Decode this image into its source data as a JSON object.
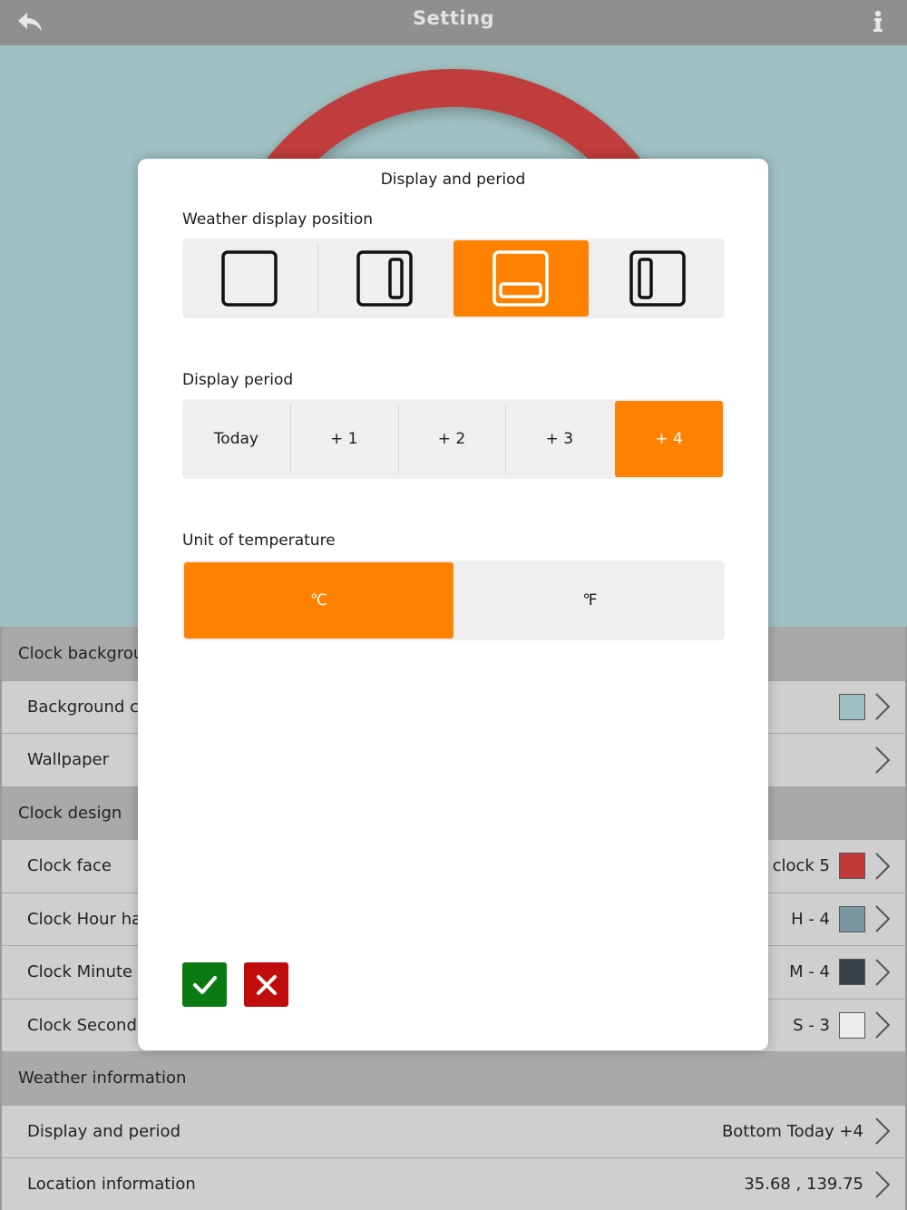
{
  "topbar": {
    "title": "Setting",
    "back_icon": "back-arrow-icon",
    "info_icon": "info-icon"
  },
  "colors": {
    "accent": "#ff8100",
    "ok": "#0b7a13",
    "cancel": "#c10c0c",
    "ring": "#bf3d3c"
  },
  "settings": {
    "rows": [
      {
        "type": "section",
        "label": "Clock background"
      },
      {
        "type": "item",
        "label": "Background color",
        "value": "",
        "swatch": "#a0c1c3"
      },
      {
        "type": "item",
        "label": "Wallpaper",
        "value": "",
        "swatch": null
      },
      {
        "type": "section",
        "label": "Clock design"
      },
      {
        "type": "item",
        "label": "Clock face",
        "value": "clock 5",
        "swatch": "#c23a38"
      },
      {
        "type": "item",
        "label": "Clock Hour hand",
        "value": "H - 4",
        "swatch": "#7b95a3"
      },
      {
        "type": "item",
        "label": "Clock Minute hand",
        "value": "M - 4",
        "swatch": "#3c424b"
      },
      {
        "type": "item",
        "label": "Clock Second hand",
        "value": "S - 3",
        "swatch": "#ececec"
      },
      {
        "type": "section",
        "label": "Weather information"
      },
      {
        "type": "item",
        "label": "Display and period",
        "value": "Bottom Today +4",
        "swatch": null
      },
      {
        "type": "item",
        "label": "Location information",
        "value": "35.68 , 139.75",
        "swatch": null
      }
    ]
  },
  "dialog": {
    "title": "Display and period",
    "position_label": "Weather display position",
    "positions": [
      {
        "name": "none",
        "selected": false
      },
      {
        "name": "right",
        "selected": false
      },
      {
        "name": "bottom",
        "selected": true
      },
      {
        "name": "left",
        "selected": false
      }
    ],
    "period_label": "Display period",
    "periods": [
      {
        "label": "Today",
        "selected": false
      },
      {
        "label": "+ 1",
        "selected": false
      },
      {
        "label": "+ 2",
        "selected": false
      },
      {
        "label": "+ 3",
        "selected": false
      },
      {
        "label": "+ 4",
        "selected": true
      }
    ],
    "unit_label": "Unit of temperature",
    "units": [
      {
        "label": "℃",
        "selected": true
      },
      {
        "label": "℉",
        "selected": false
      }
    ],
    "ok_icon": "check-icon",
    "cancel_icon": "close-icon"
  }
}
